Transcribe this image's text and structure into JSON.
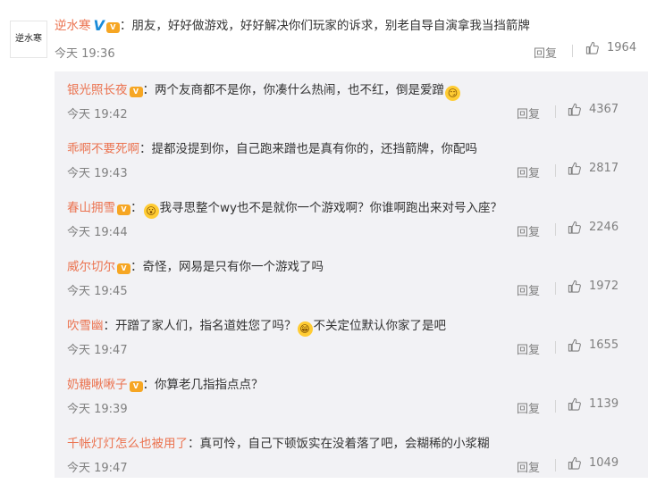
{
  "main_comment": {
    "avatar_text": "逆水寒",
    "username": "逆水寒",
    "verified_badge": "V",
    "user_badge": "V",
    "text": "：朋友，好好做游戏，好好解决你们玩家的诉求，别老自导自演拿我当挡箭牌",
    "time": "今天 19:36",
    "reply_label": "回复",
    "likes": "1964"
  },
  "replies": [
    {
      "username": "银光照长夜",
      "badge": "V",
      "text_before": "：两个友商都不是你，你凑什么热闹，也不红，倒是爱蹭",
      "emoji": "😏",
      "text_after": "",
      "time": "今天 19:42",
      "reply_label": "回复",
      "likes": "4367"
    },
    {
      "username": "乖啊不要死啊",
      "badge": "",
      "text_before": "：提都没提到你，自己跑来蹭也是真有你的，还挡箭牌，你配吗",
      "emoji": "",
      "text_after": "",
      "time": "今天 19:43",
      "reply_label": "回复",
      "likes": "2817"
    },
    {
      "username": "春山拥雪",
      "badge": "V",
      "text_before": "：",
      "emoji": "😮",
      "text_after": "我寻思整个wy也不是就你一个游戏啊？你谁啊跑出来对号入座？",
      "time": "今天 19:44",
      "reply_label": "回复",
      "likes": "2246"
    },
    {
      "username": "威尔切尔",
      "badge": "V",
      "text_before": "：奇怪，网易是只有你一个游戏了吗",
      "emoji": "",
      "text_after": "",
      "time": "今天 19:45",
      "reply_label": "回复",
      "likes": "1972"
    },
    {
      "username": "吹雪幽",
      "badge": "",
      "text_before": "：开蹭了家人们，指名道姓您了吗？",
      "emoji": "😁",
      "text_after": "不关定位默认你家了是吧",
      "time": "今天 19:47",
      "reply_label": "回复",
      "likes": "1655"
    },
    {
      "username": "奶糖啾啾子",
      "badge": "V",
      "text_before": "：你算老几指指点点？",
      "emoji": "",
      "text_after": "",
      "time": "今天 19:39",
      "reply_label": "回复",
      "likes": "1139"
    },
    {
      "username": "千帐灯灯怎么也被用了",
      "badge": "",
      "text_before": "：真可怜，自己下顿饭实在没着落了吧，会糊稀的小浆糊",
      "emoji": "",
      "text_after": "",
      "time": "今天 19:47",
      "reply_label": "回复",
      "likes": "1049"
    }
  ],
  "colors": {
    "username": "#eb7350",
    "meta": "#808080",
    "reply_bg": "#f2f2f5",
    "verified": "#1a8bd8"
  }
}
